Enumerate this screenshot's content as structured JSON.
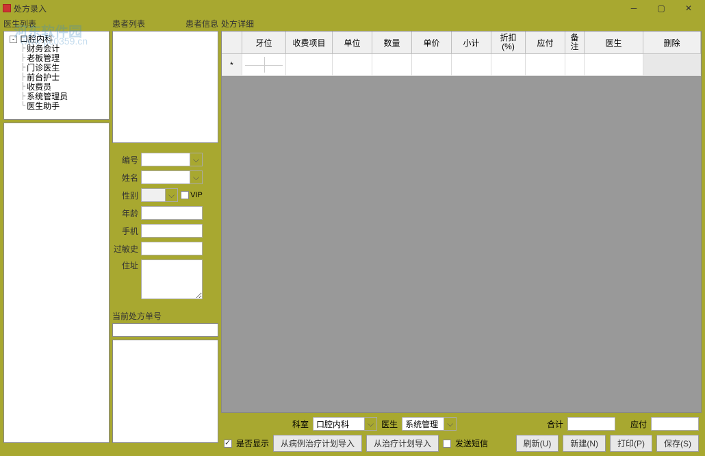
{
  "window": {
    "title": "处方录入"
  },
  "watermark": {
    "name": "河东软件园",
    "url": "www.pc0359.cn"
  },
  "nav": {
    "doctor_list_label": "医生列表",
    "patient_list_label": "患者列表",
    "patient_info_label": "患者信息",
    "prescription_detail_label": "处方详细"
  },
  "tree": {
    "root": "口腔内科",
    "children": [
      "财务会计",
      "老板管理",
      "门诊医生",
      "前台护士",
      "收费员",
      "系统管理员",
      "医生助手"
    ]
  },
  "patient_form": {
    "id_label": "编号",
    "name_label": "姓名",
    "gender_label": "性别",
    "vip_label": "VIP",
    "age_label": "年龄",
    "phone_label": "手机",
    "allergy_label": "过敏史",
    "address_label": "住址",
    "current_prescription_label": "当前处方单号"
  },
  "table": {
    "headers": {
      "tooth": "牙位",
      "charge_item": "收费项目",
      "unit": "单位",
      "quantity": "数量",
      "price": "单价",
      "subtotal": "小计",
      "discount": "折扣\n(%)",
      "payable": "应付",
      "note": "备注",
      "doctor": "医生",
      "delete": "删除"
    },
    "new_row_marker": "*"
  },
  "bottom": {
    "dept_label": "科室",
    "dept_value": "口腔内科",
    "doctor_label": "医生",
    "doctor_value": "系统管理",
    "total_label": "合计",
    "payable_label": "应付",
    "show_checkbox_label": "是否显示",
    "import_from_case_plan": "从病例治疗计划导入",
    "import_from_plan": "从治疗计划导入",
    "send_sms_label": "发送短信",
    "refresh": "刷新(U)",
    "new": "新建(N)",
    "print": "打印(P)",
    "save": "保存(S)"
  }
}
